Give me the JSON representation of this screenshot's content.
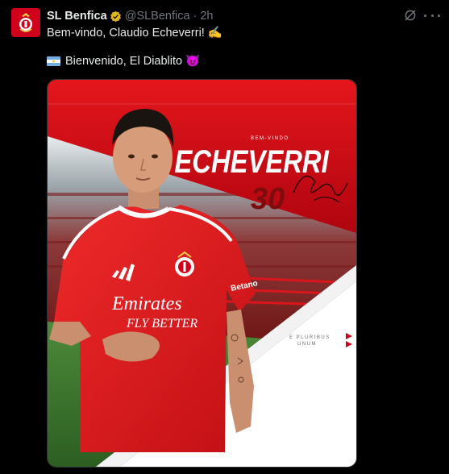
{
  "tweet": {
    "display_name": "SL Benfica",
    "handle": "@SLBenfica",
    "separator": "·",
    "time": "2h",
    "line1": "Bem-vindo, Claudio Echeverri! ✍️",
    "line2": "Bienvenido, El Diablito 😈"
  },
  "poster": {
    "top_label": "BEM-VINDO",
    "surname": "ECHEVERRI",
    "number": "30",
    "motto_line1": "E PLURIBUS",
    "motto_line2": "UNUM",
    "sponsor_line1": "Emirates",
    "sponsor_line2": "FLY BETTER",
    "sleeve_brand": "Betano"
  },
  "colors": {
    "benfica_red": "#d0021b",
    "verified_gold": "#e2b719",
    "muted": "#71767b"
  },
  "icons": [
    "benfica-crest-icon",
    "verified-badge-icon",
    "grok-icon",
    "more-icon",
    "argentina-flag-icon"
  ]
}
